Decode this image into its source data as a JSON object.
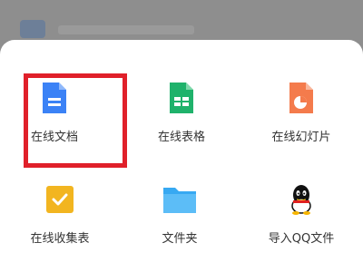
{
  "background": {
    "dimmed_color": "#8f8f8f"
  },
  "sheet": {
    "items": [
      {
        "label": "在线文档",
        "icon": "doc-icon",
        "color": "#3b82f6"
      },
      {
        "label": "在线表格",
        "icon": "sheet-icon",
        "color": "#1fb26b"
      },
      {
        "label": "在线幻灯片",
        "icon": "slides-icon",
        "color": "#f47b4c"
      },
      {
        "label": "在线收集表",
        "icon": "form-icon",
        "color": "#f2b520"
      },
      {
        "label": "文件夹",
        "icon": "folder-icon",
        "color": "#37a9f2"
      },
      {
        "label": "导入QQ文件",
        "icon": "qq-icon",
        "color": "#111111"
      }
    ]
  },
  "highlight": {
    "color": "#e0202a"
  }
}
